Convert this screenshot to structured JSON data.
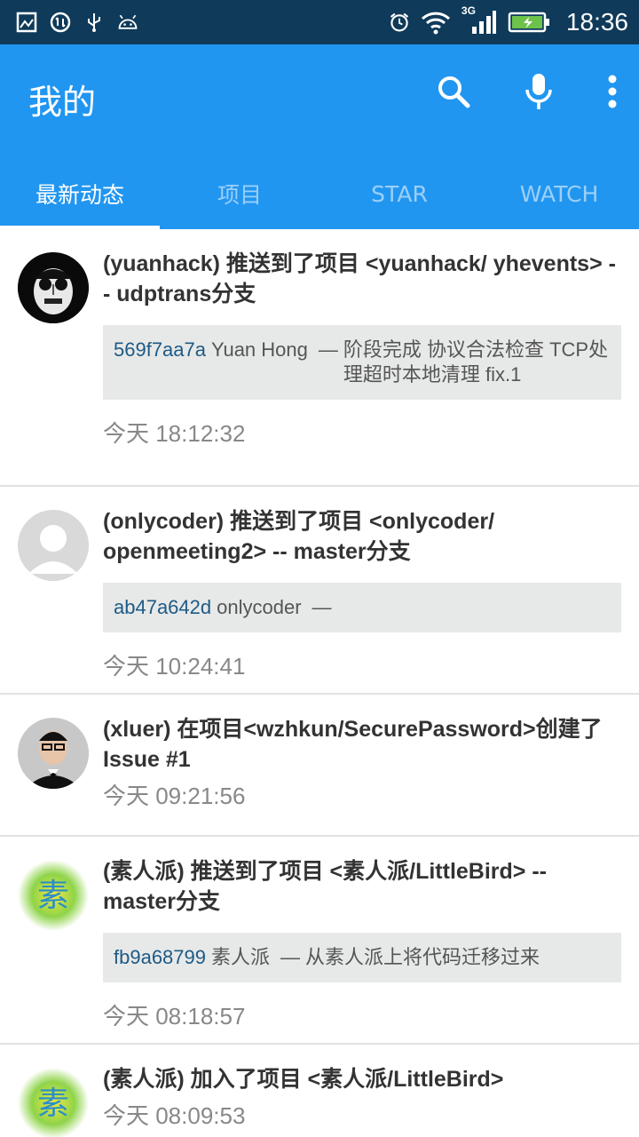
{
  "status_bar": {
    "time": "18:36",
    "network": "3G",
    "left_icons": [
      "image-icon",
      "sync-icon",
      "usb-icon",
      "android-icon"
    ],
    "right_icons": [
      "alarm-icon",
      "wifi-icon",
      "signal-icon",
      "battery-icon"
    ]
  },
  "appbar": {
    "title": "我的",
    "color": "#2196f0",
    "actions": [
      "search-icon",
      "mic-icon",
      "more-vert-icon"
    ]
  },
  "tabs": [
    {
      "label": "最新动态",
      "active": true
    },
    {
      "label": "项目",
      "active": false
    },
    {
      "label": "STAR",
      "active": false
    },
    {
      "label": "WATCH",
      "active": false
    }
  ],
  "feed": [
    {
      "title": "(yuanhack) 推送到了项目 <yuanhack/ yhevents> -- udptrans分支",
      "commit": {
        "sha": "569f7aa7a",
        "author": "Yuan Hong",
        "dash": "—",
        "message": "阶段完成 协议合法检查 TCP处理超时本地清理 fix.1"
      },
      "time": "今天 18:12:32"
    },
    {
      "title": "(onlycoder) 推送到了项目 <onlycoder/ openmeeting2> -- master分支",
      "commit": {
        "sha": "ab47a642d",
        "author": "onlycoder",
        "dash": "—",
        "message": ""
      },
      "time": "今天 10:24:41"
    },
    {
      "title": "(xluer) 在项目<wzhkun/SecurePassword>创建了Issue #1",
      "time": "今天 09:21:56"
    },
    {
      "title": "(素人派) 推送到了项目 <素人派/LittleBird> -- master分支",
      "commit": {
        "sha": "fb9a68799",
        "author": "素人派",
        "dash": "—",
        "message": "从素人派上将代码迁移过来"
      },
      "time": "今天 08:18:57"
    },
    {
      "title": "(素人派) 加入了项目 <素人派/LittleBird>",
      "time": "今天 08:09:53"
    }
  ]
}
